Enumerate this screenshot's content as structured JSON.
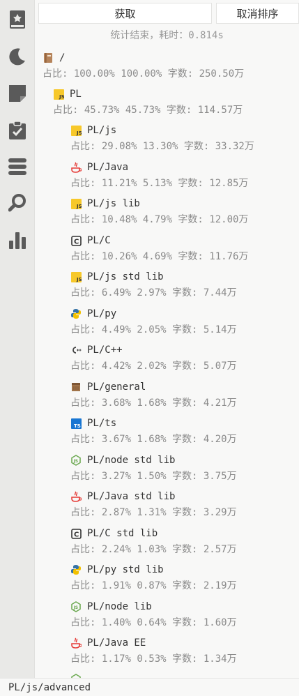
{
  "toolbar": {
    "fetch_label": "获取",
    "cancel_sort_label": "取消排序"
  },
  "status": {
    "prefix": "统计结束，耗时：",
    "elapsed": "0.814s"
  },
  "sidebar": {
    "items": [
      {
        "icon": "bookmark-book-icon"
      },
      {
        "icon": "moon-icon"
      },
      {
        "icon": "note-icon"
      },
      {
        "icon": "clipboard-check-icon"
      },
      {
        "icon": "stack-icon"
      },
      {
        "icon": "search-icon"
      },
      {
        "icon": "bar-chart-icon"
      }
    ]
  },
  "entries": [
    {
      "path": "/",
      "icon": "notebook-icon",
      "stat": "占比: 100.00% 100.00% 字数: 250.50万"
    },
    {
      "path": "PL",
      "icon": "js-icon",
      "stat": "占比: 45.73% 45.73% 字数: 114.57万"
    },
    {
      "path": "PL/js",
      "icon": "js-icon",
      "stat": "占比: 29.08% 13.30% 字数: 33.32万"
    },
    {
      "path": "PL/Java",
      "icon": "java-icon",
      "stat": "占比: 11.21% 5.13% 字数: 12.85万"
    },
    {
      "path": "PL/js lib",
      "icon": "js-icon",
      "stat": "占比: 10.48% 4.79% 字数: 12.00万"
    },
    {
      "path": "PL/C",
      "icon": "c-icon",
      "stat": "占比: 10.26% 4.69% 字数: 11.76万"
    },
    {
      "path": "PL/js std lib",
      "icon": "js-icon",
      "stat": "占比: 6.49% 2.97% 字数: 7.44万"
    },
    {
      "path": "PL/py",
      "icon": "python-icon",
      "stat": "占比: 4.49% 2.05% 字数: 5.14万"
    },
    {
      "path": "PL/C++",
      "icon": "cpp-icon",
      "stat": "占比: 4.42% 2.02% 字数: 5.07万"
    },
    {
      "path": "PL/general",
      "icon": "box-icon",
      "stat": "占比: 3.68% 1.68% 字数: 4.21万"
    },
    {
      "path": "PL/ts",
      "icon": "ts-icon",
      "stat": "占比: 3.67% 1.68% 字数: 4.20万"
    },
    {
      "path": "PL/node std lib",
      "icon": "node-icon",
      "stat": "占比: 3.27% 1.50% 字数: 3.75万"
    },
    {
      "path": "PL/Java std lib",
      "icon": "java-icon",
      "stat": "占比: 2.87% 1.31% 字数: 3.29万"
    },
    {
      "path": "PL/C std lib",
      "icon": "c-icon",
      "stat": "占比: 2.24% 1.03% 字数: 2.57万"
    },
    {
      "path": "PL/py std lib",
      "icon": "python-icon",
      "stat": "占比: 1.91% 0.87% 字数: 2.19万"
    },
    {
      "path": "PL/node lib",
      "icon": "node-icon",
      "stat": "占比: 1.40% 0.64% 字数: 1.60万"
    },
    {
      "path": "PL/Java EE",
      "icon": "java-icon",
      "stat": "占比: 1.17% 0.53% 字数: 1.34万"
    }
  ],
  "footer": {
    "path": "PL/js/advanced"
  },
  "colors": {
    "js": "#f7c82a",
    "ts": "#1976d2",
    "node": "#6aa84f",
    "java": "#e53935",
    "python_blue": "#3572a5",
    "python_yellow": "#f2c100",
    "notebook": "#b5835a",
    "box": "#a1744a",
    "sidebar_icon": "#5a5a5a"
  }
}
